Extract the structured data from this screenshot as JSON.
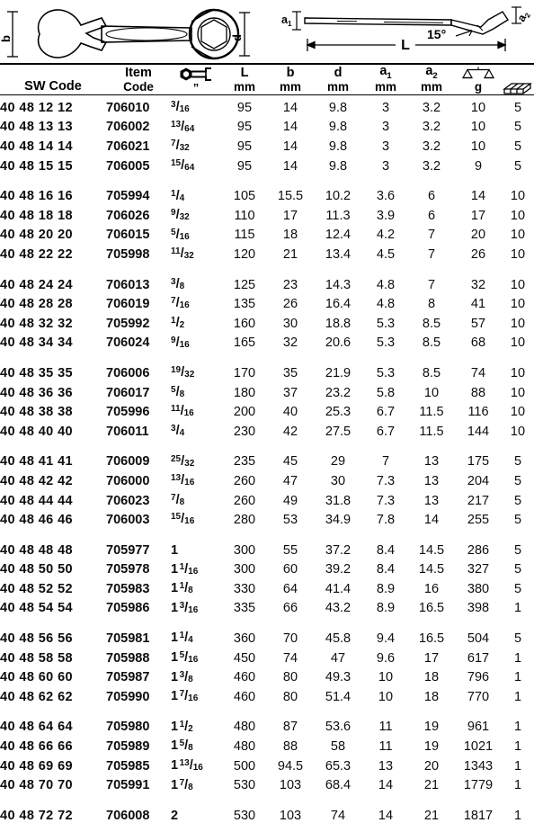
{
  "diagram": {
    "left": {
      "name": "combination-wrench-front-view",
      "labels": [
        "b",
        "d"
      ]
    },
    "right": {
      "name": "combination-wrench-side-view",
      "labels": [
        "a1",
        "a2",
        "L",
        "15°"
      ],
      "angle_label": "15°",
      "length_label": "L",
      "a1_label": "a",
      "a1_sub": "1",
      "a2_label": "a",
      "a2_sub": "2"
    }
  },
  "table": {
    "columns": [
      {
        "key": "sw",
        "label": "SW Code",
        "unit": ""
      },
      {
        "key": "item",
        "label": "Item",
        "unit": "Code"
      },
      {
        "key": "inch",
        "label": "hex-wrench-icon",
        "unit": "”"
      },
      {
        "key": "l",
        "label": "L",
        "unit": "mm"
      },
      {
        "key": "b",
        "label": "b",
        "unit": "mm"
      },
      {
        "key": "d",
        "label": "d",
        "unit": "mm"
      },
      {
        "key": "a1",
        "label": "a",
        "sub": "1",
        "unit": "mm"
      },
      {
        "key": "a2",
        "label": "a",
        "sub": "2",
        "unit": "mm"
      },
      {
        "key": "g",
        "label": "scales-icon",
        "unit": "g"
      },
      {
        "key": "pack",
        "label": "box-icon",
        "unit": ""
      }
    ],
    "groups": [
      {
        "rows": [
          {
            "sw": "40 48 12 12",
            "item": "706010",
            "inch": {
              "whole": "",
              "num": "3",
              "den": "16"
            },
            "l": "95",
            "b": "14",
            "d": "9.8",
            "a1": "3",
            "a2": "3.2",
            "g": "10",
            "pack": "5"
          },
          {
            "sw": "40 48 13 13",
            "item": "706002",
            "inch": {
              "whole": "",
              "num": "13",
              "den": "64"
            },
            "l": "95",
            "b": "14",
            "d": "9.8",
            "a1": "3",
            "a2": "3.2",
            "g": "10",
            "pack": "5"
          },
          {
            "sw": "40 48 14 14",
            "item": "706021",
            "inch": {
              "whole": "",
              "num": "7",
              "den": "32"
            },
            "l": "95",
            "b": "14",
            "d": "9.8",
            "a1": "3",
            "a2": "3.2",
            "g": "10",
            "pack": "5"
          },
          {
            "sw": "40 48 15 15",
            "item": "706005",
            "inch": {
              "whole": "",
              "num": "15",
              "den": "64"
            },
            "l": "95",
            "b": "14",
            "d": "9.8",
            "a1": "3",
            "a2": "3.2",
            "g": "9",
            "pack": "5"
          }
        ]
      },
      {
        "rows": [
          {
            "sw": "40 48 16 16",
            "item": "705994",
            "inch": {
              "whole": "",
              "num": "1",
              "den": "4"
            },
            "l": "105",
            "b": "15.5",
            "d": "10.2",
            "a1": "3.6",
            "a2": "6",
            "g": "14",
            "pack": "10"
          },
          {
            "sw": "40 48 18 18",
            "item": "706026",
            "inch": {
              "whole": "",
              "num": "9",
              "den": "32"
            },
            "l": "110",
            "b": "17",
            "d": "11.3",
            "a1": "3.9",
            "a2": "6",
            "g": "17",
            "pack": "10"
          },
          {
            "sw": "40 48 20 20",
            "item": "706015",
            "inch": {
              "whole": "",
              "num": "5",
              "den": "16"
            },
            "l": "115",
            "b": "18",
            "d": "12.4",
            "a1": "4.2",
            "a2": "7",
            "g": "20",
            "pack": "10"
          },
          {
            "sw": "40 48 22 22",
            "item": "705998",
            "inch": {
              "whole": "",
              "num": "11",
              "den": "32"
            },
            "l": "120",
            "b": "21",
            "d": "13.4",
            "a1": "4.5",
            "a2": "7",
            "g": "26",
            "pack": "10"
          }
        ]
      },
      {
        "rows": [
          {
            "sw": "40 48 24 24",
            "item": "706013",
            "inch": {
              "whole": "",
              "num": "3",
              "den": "8"
            },
            "l": "125",
            "b": "23",
            "d": "14.3",
            "a1": "4.8",
            "a2": "7",
            "g": "32",
            "pack": "10"
          },
          {
            "sw": "40 48 28 28",
            "item": "706019",
            "inch": {
              "whole": "",
              "num": "7",
              "den": "16"
            },
            "l": "135",
            "b": "26",
            "d": "16.4",
            "a1": "4.8",
            "a2": "8",
            "g": "41",
            "pack": "10"
          },
          {
            "sw": "40 48 32 32",
            "item": "705992",
            "inch": {
              "whole": "",
              "num": "1",
              "den": "2"
            },
            "l": "160",
            "b": "30",
            "d": "18.8",
            "a1": "5.3",
            "a2": "8.5",
            "g": "57",
            "pack": "10"
          },
          {
            "sw": "40 48 34 34",
            "item": "706024",
            "inch": {
              "whole": "",
              "num": "9",
              "den": "16"
            },
            "l": "165",
            "b": "32",
            "d": "20.6",
            "a1": "5.3",
            "a2": "8.5",
            "g": "68",
            "pack": "10"
          }
        ]
      },
      {
        "rows": [
          {
            "sw": "40 48 35 35",
            "item": "706006",
            "inch": {
              "whole": "",
              "num": "19",
              "den": "32"
            },
            "l": "170",
            "b": "35",
            "d": "21.9",
            "a1": "5.3",
            "a2": "8.5",
            "g": "74",
            "pack": "10"
          },
          {
            "sw": "40 48 36 36",
            "item": "706017",
            "inch": {
              "whole": "",
              "num": "5",
              "den": "8"
            },
            "l": "180",
            "b": "37",
            "d": "23.2",
            "a1": "5.8",
            "a2": "10",
            "g": "88",
            "pack": "10"
          },
          {
            "sw": "40 48 38 38",
            "item": "705996",
            "inch": {
              "whole": "",
              "num": "11",
              "den": "16"
            },
            "l": "200",
            "b": "40",
            "d": "25.3",
            "a1": "6.7",
            "a2": "11.5",
            "g": "116",
            "pack": "10"
          },
          {
            "sw": "40 48 40 40",
            "item": "706011",
            "inch": {
              "whole": "",
              "num": "3",
              "den": "4"
            },
            "l": "230",
            "b": "42",
            "d": "27.5",
            "a1": "6.7",
            "a2": "11.5",
            "g": "144",
            "pack": "10"
          }
        ]
      },
      {
        "rows": [
          {
            "sw": "40 48 41 41",
            "item": "706009",
            "inch": {
              "whole": "",
              "num": "25",
              "den": "32"
            },
            "l": "235",
            "b": "45",
            "d": "29",
            "a1": "7",
            "a2": "13",
            "g": "175",
            "pack": "5"
          },
          {
            "sw": "40 48 42 42",
            "item": "706000",
            "inch": {
              "whole": "",
              "num": "13",
              "den": "16"
            },
            "l": "260",
            "b": "47",
            "d": "30",
            "a1": "7.3",
            "a2": "13",
            "g": "204",
            "pack": "5"
          },
          {
            "sw": "40 48 44 44",
            "item": "706023",
            "inch": {
              "whole": "",
              "num": "7",
              "den": "8"
            },
            "l": "260",
            "b": "49",
            "d": "31.8",
            "a1": "7.3",
            "a2": "13",
            "g": "217",
            "pack": "5"
          },
          {
            "sw": "40 48 46 46",
            "item": "706003",
            "inch": {
              "whole": "",
              "num": "15",
              "den": "16"
            },
            "l": "280",
            "b": "53",
            "d": "34.9",
            "a1": "7.8",
            "a2": "14",
            "g": "255",
            "pack": "5"
          }
        ]
      },
      {
        "rows": [
          {
            "sw": "40 48 48 48",
            "item": "705977",
            "inch": {
              "whole": "1",
              "num": "",
              "den": ""
            },
            "l": "300",
            "b": "55",
            "d": "37.2",
            "a1": "8.4",
            "a2": "14.5",
            "g": "286",
            "pack": "5"
          },
          {
            "sw": "40 48 50 50",
            "item": "705978",
            "inch": {
              "whole": "1",
              "num": "1",
              "den": "16"
            },
            "l": "300",
            "b": "60",
            "d": "39.2",
            "a1": "8.4",
            "a2": "14.5",
            "g": "327",
            "pack": "5"
          },
          {
            "sw": "40 48 52 52",
            "item": "705983",
            "inch": {
              "whole": "1",
              "num": "1",
              "den": "8"
            },
            "l": "330",
            "b": "64",
            "d": "41.4",
            "a1": "8.9",
            "a2": "16",
            "g": "380",
            "pack": "5"
          },
          {
            "sw": "40 48 54 54",
            "item": "705986",
            "inch": {
              "whole": "1",
              "num": "3",
              "den": "16"
            },
            "l": "335",
            "b": "66",
            "d": "43.2",
            "a1": "8.9",
            "a2": "16.5",
            "g": "398",
            "pack": "1"
          }
        ]
      },
      {
        "rows": [
          {
            "sw": "40 48 56 56",
            "item": "705981",
            "inch": {
              "whole": "1",
              "num": "1",
              "den": "4"
            },
            "l": "360",
            "b": "70",
            "d": "45.8",
            "a1": "9.4",
            "a2": "16.5",
            "g": "504",
            "pack": "5"
          },
          {
            "sw": "40 48 58 58",
            "item": "705988",
            "inch": {
              "whole": "1",
              "num": "5",
              "den": "16"
            },
            "l": "450",
            "b": "74",
            "d": "47",
            "a1": "9.6",
            "a2": "17",
            "g": "617",
            "pack": "1"
          },
          {
            "sw": "40 48 60 60",
            "item": "705987",
            "inch": {
              "whole": "1",
              "num": "3",
              "den": "8"
            },
            "l": "460",
            "b": "80",
            "d": "49.3",
            "a1": "10",
            "a2": "18",
            "g": "796",
            "pack": "1"
          },
          {
            "sw": "40 48 62 62",
            "item": "705990",
            "inch": {
              "whole": "1",
              "num": "7",
              "den": "16"
            },
            "l": "460",
            "b": "80",
            "d": "51.4",
            "a1": "10",
            "a2": "18",
            "g": "770",
            "pack": "1"
          }
        ]
      },
      {
        "rows": [
          {
            "sw": "40 48 64 64",
            "item": "705980",
            "inch": {
              "whole": "1",
              "num": "1",
              "den": "2"
            },
            "l": "480",
            "b": "87",
            "d": "53.6",
            "a1": "11",
            "a2": "19",
            "g": "961",
            "pack": "1"
          },
          {
            "sw": "40 48 66 66",
            "item": "705989",
            "inch": {
              "whole": "1",
              "num": "5",
              "den": "8"
            },
            "l": "480",
            "b": "88",
            "d": "58",
            "a1": "11",
            "a2": "19",
            "g": "1021",
            "pack": "1"
          },
          {
            "sw": "40 48 69 69",
            "item": "705985",
            "inch": {
              "whole": "1",
              "num": "13",
              "den": "16"
            },
            "l": "500",
            "b": "94.5",
            "d": "65.3",
            "a1": "13",
            "a2": "20",
            "g": "1343",
            "pack": "1"
          },
          {
            "sw": "40 48 70 70",
            "item": "705991",
            "inch": {
              "whole": "1",
              "num": "7",
              "den": "8"
            },
            "l": "530",
            "b": "103",
            "d": "68.4",
            "a1": "14",
            "a2": "21",
            "g": "1779",
            "pack": "1"
          }
        ]
      },
      {
        "rows": [
          {
            "sw": "40 48 72 72",
            "item": "706008",
            "inch": {
              "whole": "2",
              "num": "",
              "den": ""
            },
            "l": "530",
            "b": "103",
            "d": "74",
            "a1": "14",
            "a2": "21",
            "g": "1817",
            "pack": "1"
          }
        ]
      }
    ]
  },
  "colors": {
    "ink": "#000000",
    "text": "#0d0d0d",
    "background": "#ffffff"
  }
}
